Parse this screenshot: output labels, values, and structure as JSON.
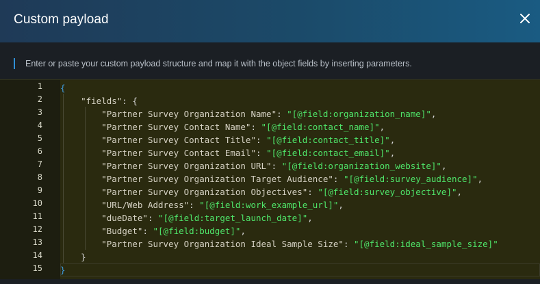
{
  "dialog": {
    "title": "Custom payload",
    "description": "Enter or paste your custom payload structure and map it with the object fields by inserting parameters."
  },
  "colors": {
    "accent": "#2f8fd6",
    "string": "#4fe66a",
    "editor_bg": "#2a2a0f"
  },
  "editor": {
    "line_numbers": [
      "1",
      "2",
      "3",
      "4",
      "5",
      "6",
      "7",
      "8",
      "9",
      "10",
      "11",
      "12",
      "13",
      "14",
      "15"
    ],
    "lines": [
      {
        "indent": "",
        "key": "",
        "value": "",
        "raw": "{"
      },
      {
        "indent": "    ",
        "key": "\"fields\"",
        "value": "",
        "raw": ": {"
      },
      {
        "indent": "        ",
        "key": "\"Partner Survey Organization Name\"",
        "value": "\"[@field:organization_name]\"",
        "raw": ","
      },
      {
        "indent": "        ",
        "key": "\"Partner Survey Contact Name\"",
        "value": "\"[@field:contact_name]\"",
        "raw": ","
      },
      {
        "indent": "        ",
        "key": "\"Partner Survey Contact Title\"",
        "value": "\"[@field:contact_title]\"",
        "raw": ","
      },
      {
        "indent": "        ",
        "key": "\"Partner Survey Contact Email\"",
        "value": "\"[@field:contact_email]\"",
        "raw": ","
      },
      {
        "indent": "        ",
        "key": "\"Partner Survey Organization URL\"",
        "value": "\"[@field:organization_website]\"",
        "raw": ","
      },
      {
        "indent": "        ",
        "key": "\"Partner Survey Organization Target Audience\"",
        "value": "\"[@field:survey_audience]\"",
        "raw": ","
      },
      {
        "indent": "        ",
        "key": "\"Partner Survey Organization Objectives\"",
        "value": "\"[@field:survey_objective]\"",
        "raw": ","
      },
      {
        "indent": "        ",
        "key": "\"URL/Web Address\"",
        "value": "\"[@field:work_example_url]\"",
        "raw": ","
      },
      {
        "indent": "        ",
        "key": "\"dueDate\"",
        "value": "\"[@field:target_launch_date]\"",
        "raw": ","
      },
      {
        "indent": "        ",
        "key": "\"Budget\"",
        "value": "\"[@field:budget]\"",
        "raw": ","
      },
      {
        "indent": "        ",
        "key": "\"Partner Survey Organization Ideal Sample Size\"",
        "value": "\"[@field:ideal_sample_size]\"",
        "raw": ""
      },
      {
        "indent": "    ",
        "key": "",
        "value": "",
        "raw": "}"
      },
      {
        "indent": "",
        "key": "",
        "value": "",
        "raw": "}"
      }
    ]
  }
}
